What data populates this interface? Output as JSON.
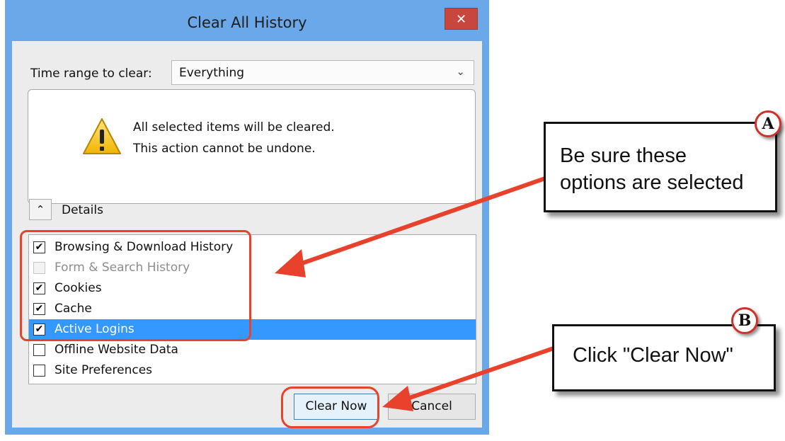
{
  "window": {
    "title": "Clear All History",
    "close_symbol": "✕"
  },
  "time_range": {
    "label": "Time range to clear:",
    "selected": "Everything",
    "arrow_symbol": "⌄"
  },
  "warning": {
    "icon": "warning-triangle-icon",
    "line1": "All selected items will be cleared.",
    "line2": "This action cannot be undone."
  },
  "details": {
    "toggle_symbol": "⌃",
    "label": "Details"
  },
  "items": [
    {
      "label": "Browsing & Download History",
      "checked": true,
      "disabled": false,
      "selected": false,
      "mark": "✔"
    },
    {
      "label": "Form & Search History",
      "checked": false,
      "disabled": true,
      "selected": false,
      "mark": ""
    },
    {
      "label": "Cookies",
      "checked": true,
      "disabled": false,
      "selected": false,
      "mark": "✔"
    },
    {
      "label": "Cache",
      "checked": true,
      "disabled": false,
      "selected": false,
      "mark": "✔"
    },
    {
      "label": "Active Logins",
      "checked": true,
      "disabled": false,
      "selected": true,
      "mark": "✔"
    },
    {
      "label": "Offline Website Data",
      "checked": false,
      "disabled": false,
      "selected": false,
      "mark": ""
    },
    {
      "label": "Site Preferences",
      "checked": false,
      "disabled": false,
      "selected": false,
      "mark": ""
    }
  ],
  "buttons": {
    "clear_now": "Clear Now",
    "cancel": "Cancel"
  },
  "annotations": {
    "a": {
      "badge": "A",
      "line1": "Be sure these",
      "line2": "options are selected"
    },
    "b": {
      "badge": "B",
      "text": "Click \"Clear Now\""
    },
    "accent_color": "#e8412c"
  }
}
